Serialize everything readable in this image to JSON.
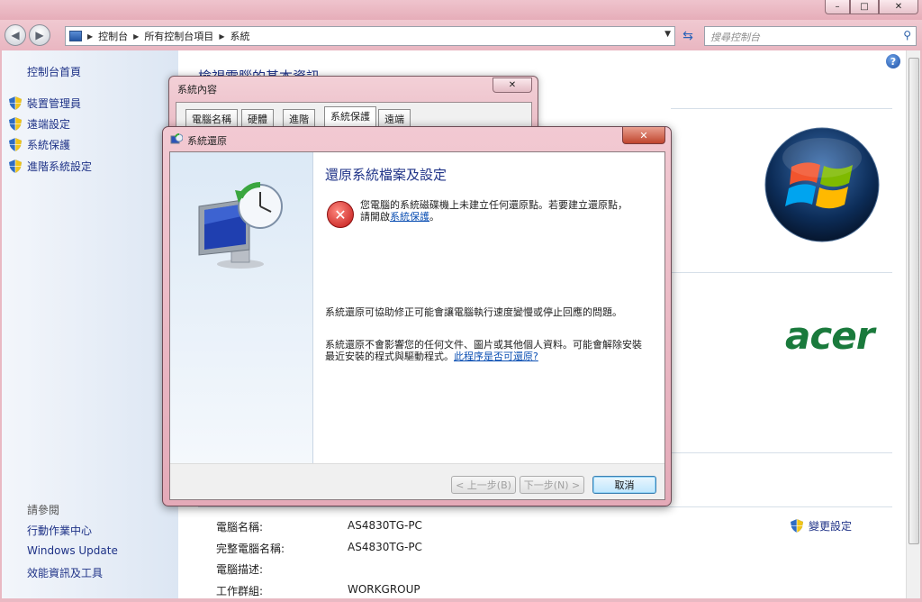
{
  "window": {
    "controls": {
      "minimize": "–",
      "maximize": "□",
      "close": "✕"
    }
  },
  "navbar": {
    "back_icon": "◀",
    "forward_icon": "▶",
    "breadcrumb": [
      "控制台",
      "所有控制台項目",
      "系統"
    ],
    "search_placeholder": "搜尋控制台"
  },
  "sidebar": {
    "home": "控制台首頁",
    "items": [
      {
        "label": "裝置管理員"
      },
      {
        "label": "遠端設定"
      },
      {
        "label": "系統保護"
      },
      {
        "label": "進階系統設定"
      }
    ],
    "see_also_title": "請參閱",
    "see_also": [
      "行動作業中心",
      "Windows Update",
      "效能資訊及工具"
    ]
  },
  "main": {
    "heading": "檢視電腦的基本資訊",
    "info_rows": [
      {
        "label": "電腦名稱:",
        "value": "AS4830TG-PC"
      },
      {
        "label": "完整電腦名稱:",
        "value": "AS4830TG-PC"
      },
      {
        "label": "電腦描述:",
        "value": ""
      },
      {
        "label": "工作群組:",
        "value": "WORKGROUP"
      }
    ],
    "change_settings": "變更設定",
    "brand": "acer",
    "help": "?"
  },
  "sysprops": {
    "title": "系統內容",
    "close": "✕",
    "tabs": [
      "電腦名稱",
      "硬體",
      "進階",
      "系統保護",
      "遠端"
    ],
    "active_tab": "系統保護"
  },
  "restore": {
    "title": "系統還原",
    "close": "✕",
    "heading": "還原系統檔案及設定",
    "error_text_1": "您電腦的系統磁碟機上未建立任何還原點。若要建立還原點，請開啟",
    "error_link": "系統保護",
    "error_text_2": "。",
    "error_icon": "✕",
    "desc1": "系統還原可協助修正可能會讓電腦執行速度變慢或停止回應的問題。",
    "desc2_text": "系統還原不會影響您的任何文件、圖片或其他個人資料。可能會解除安裝最近安裝的程式與驅動程式。",
    "desc2_link": "此程序是否可還原?",
    "buttons": {
      "back": "< 上一步(B)",
      "next": "下一步(N) >",
      "cancel": "取消"
    }
  },
  "colors": {
    "frame": "#e9b9c3",
    "link": "#1e3287",
    "heading": "#1e3287",
    "error": "#c01414",
    "acer_green": "#1a7a3c"
  }
}
